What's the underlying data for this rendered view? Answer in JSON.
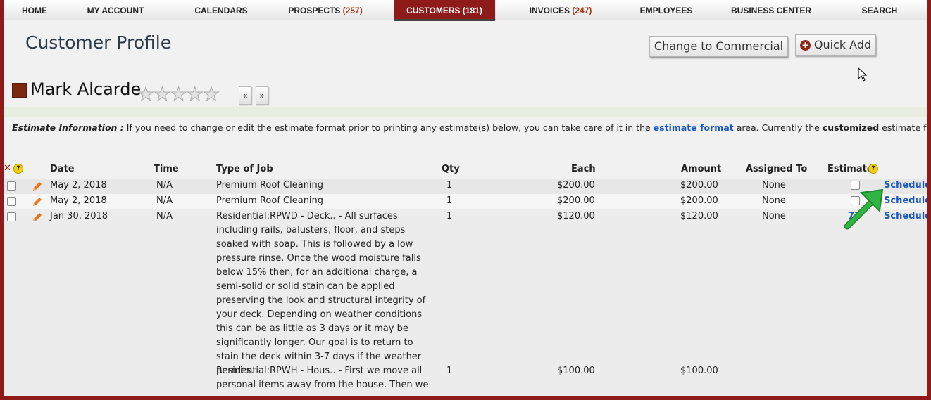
{
  "nav": {
    "home": "HOME",
    "my_account": "MY ACCOUNT",
    "calendars": "CALENDARS",
    "prospects": "PROSPECTS",
    "prospects_count": "(257)",
    "customers": "CUSTOMERS",
    "customers_count": "(181)",
    "invoices": "INVOICES",
    "invoices_count": "(247)",
    "employees": "EMPLOYEES",
    "business_center": "BUSINESS CENTER",
    "search": "SEARCH",
    "active": "CUSTOMERS"
  },
  "header": {
    "page_title": "Customer Profile",
    "change_commercial_label": "Change to Commercial",
    "quick_add_label": "Quick Add"
  },
  "customer": {
    "name": "Mark Alcarde",
    "rating": 0,
    "prev_label": "«",
    "next_label": "»"
  },
  "estimate_info": {
    "label": "Estimate Information :",
    "text1": " If you need to change or edit the estimate format prior to printing any estimate(s) below, you can take care of it in the ",
    "link": "estimate format",
    "text2": " area. Currently the ",
    "format": "customized",
    "text3": " estimate format is selected"
  },
  "table": {
    "headers": {
      "date": "Date",
      "time": "Time",
      "type": "Type of Job",
      "qty": "Qty",
      "each": "Each",
      "amount": "Amount",
      "assigned": "Assigned To",
      "estimate": "Estimate"
    },
    "rows": [
      {
        "date": "May 2, 2018",
        "time": "N/A",
        "type": "Premium Roof Cleaning",
        "qty": "1",
        "each": "$200.00",
        "amount": "$200.00",
        "assigned": "None",
        "schedule": "Schedule"
      },
      {
        "date": "May 2, 2018",
        "time": "N/A",
        "type": "Premium Roof Cleaning",
        "qty": "1",
        "each": "$200.00",
        "amount": "$200.00",
        "assigned": "None",
        "schedule": "Schedule"
      },
      {
        "date": "Jan 30, 2018",
        "time": "N/A",
        "type": "Residential:RPWD - Deck.. - All surfaces including rails, balusters, floor, and steps soaked with soap. This is followed by a low pressure rinse. Once the wood moisture falls below 15% then, for an additional charge, a semi-solid or solid stain can be applied preserving the look and structural integrity of your deck. Depending on weather conditions this can be as little as 3 days or it may be significantly longer. Our goal is to return to stain the deck within 3-7 days if the weather permits.",
        "qty": "1",
        "each": "$120.00",
        "amount": "$120.00",
        "assigned": "None",
        "estimate_number": "77",
        "schedule": "Schedule"
      },
      {
        "type": "Residential:RPWH - Hous.. - First we move all personal items away from the house. Then we",
        "qty": "1",
        "each": "$100.00",
        "amount": "$100.00"
      }
    ]
  },
  "colors": {
    "brand": "#8e1a1a",
    "link": "#1a55c4",
    "pencil": "#e8751a",
    "arrow": "#2aa23a"
  }
}
